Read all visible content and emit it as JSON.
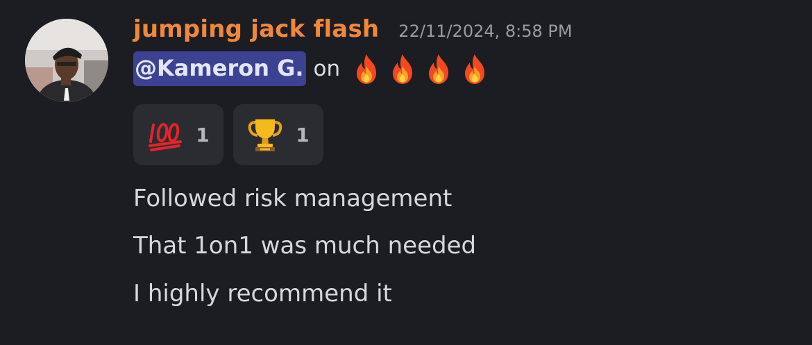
{
  "message": {
    "author": "jumping jack flash",
    "timestamp": "22/11/2024, 8:58 PM",
    "mention": "@Kameron G.",
    "mention_suffix": "on",
    "inline_emojis": [
      "fire",
      "fire",
      "fire",
      "fire"
    ],
    "reactions": [
      {
        "emoji": "hundred-points",
        "count": "1"
      },
      {
        "emoji": "trophy",
        "count": "1"
      }
    ],
    "lines": [
      "Followed risk management",
      "That 1on1 was much needed",
      "I highly recommend it"
    ]
  },
  "colors": {
    "background": "#1c1d22",
    "author": "#f0883a",
    "mention_bg": "#3c4191",
    "reaction_bg": "#2b2c32"
  }
}
